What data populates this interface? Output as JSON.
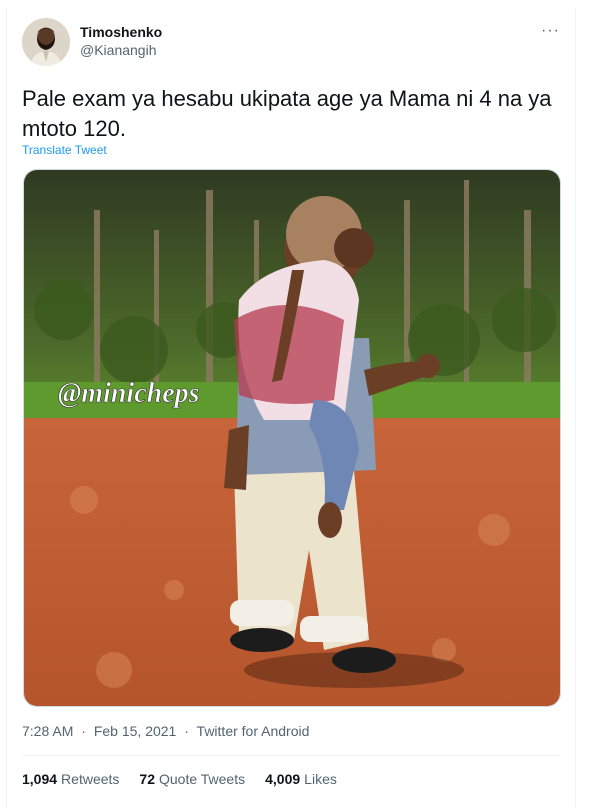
{
  "user": {
    "display_name": "Timoshenko",
    "handle": "@Kianangih"
  },
  "menu": {
    "icon": "more-horizontal-icon",
    "glyph": "···"
  },
  "tweet": {
    "text": "Pale exam ya hesabu ukipata age ya Mama ni 4 na ya mtoto 120.",
    "translate_label": "Translate Tweet",
    "media": {
      "watermark": "@minicheps"
    }
  },
  "meta": {
    "time": "7:28 AM",
    "separator": "·",
    "date": "Feb 15, 2021",
    "source": "Twitter for Android"
  },
  "stats": {
    "retweets_count": "1,094",
    "retweets_label": "Retweets",
    "quotes_count": "72",
    "quotes_label": "Quote Tweets",
    "likes_count": "4,009",
    "likes_label": "Likes"
  },
  "colors": {
    "accent": "#1d9bf0",
    "secondary_text": "#536471",
    "text": "#0f1419"
  }
}
